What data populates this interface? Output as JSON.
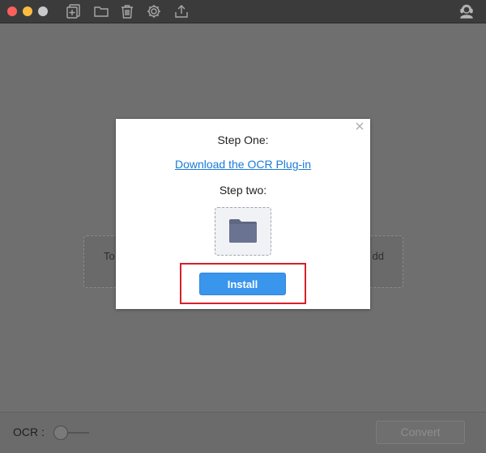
{
  "titlebar": {
    "icons": [
      "add-file-icon",
      "folder-icon",
      "trash-icon",
      "settings-gear-icon",
      "upload-icon",
      "support-agent-icon"
    ]
  },
  "dropzone": {
    "left_text": "To",
    "right_text": "dd"
  },
  "modal": {
    "step_one": "Step One:",
    "download_link": "Download the OCR Plug-in",
    "step_two": "Step two:",
    "install_label": "Install"
  },
  "bottombar": {
    "ocr_label": "OCR :",
    "ocr_enabled": false,
    "convert_label": "Convert"
  },
  "colors": {
    "install_button": "#3a95ec",
    "link": "#1a7ad9",
    "highlight_box": "#d7202a"
  }
}
